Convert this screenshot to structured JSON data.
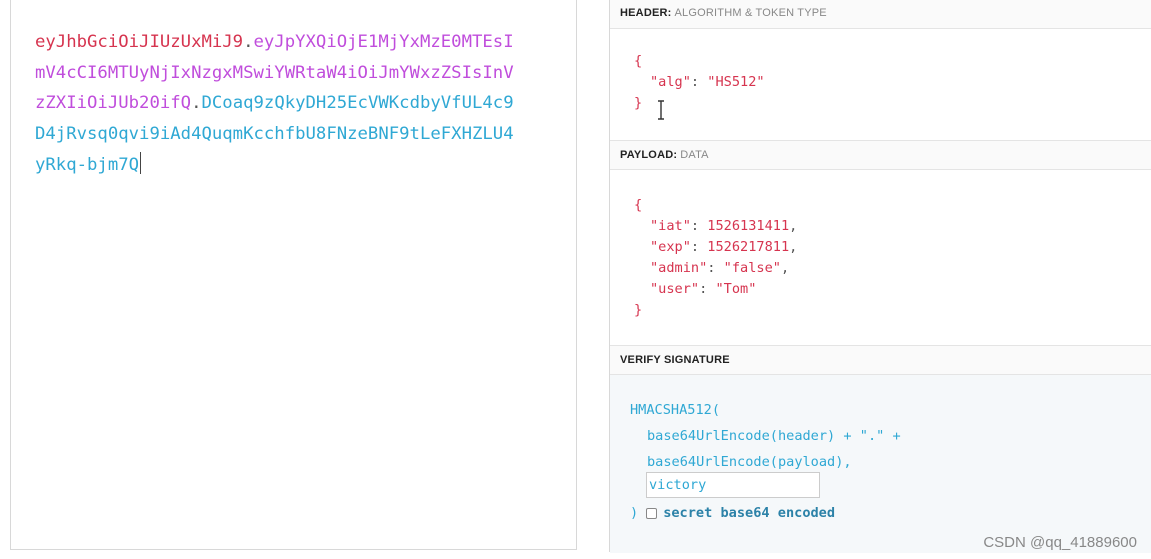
{
  "encoded": {
    "header_segment": "eyJhbGciOiJIUzUxMiJ9",
    "payload_segment": "eyJpYXQiOjE1MjYxMzE0MTEsImV4cCI6MTUyNjIxNzgxMSwiYWRtaW4iOiJmYWxzZSIsInVzZXIiOiJUb20ifQ",
    "signature_segment": "DCoaq9zQkyDH25EcVWKcdbyVfUL4c9D4jRvsq0qvi9iAd4QuqmKcchfbU8FNzeBNF9tLeFXHZLU4yRkq-bjm7Q",
    "separator": "."
  },
  "header_section": {
    "title": "HEADER:",
    "subtitle": "ALGORITHM & TOKEN TYPE",
    "open_brace": "{",
    "close_brace": "}",
    "fields": [
      {
        "key": "\"alg\"",
        "colon": ": ",
        "value": "\"HS512\"",
        "comma": ""
      }
    ]
  },
  "payload_section": {
    "title": "PAYLOAD:",
    "subtitle": "DATA",
    "open_brace": "{",
    "close_brace": "}",
    "fields": [
      {
        "key": "\"iat\"",
        "colon": ": ",
        "value": "1526131411",
        "comma": ","
      },
      {
        "key": "\"exp\"",
        "colon": ": ",
        "value": "1526217811",
        "comma": ","
      },
      {
        "key": "\"admin\"",
        "colon": ": ",
        "value": "\"false\"",
        "comma": ","
      },
      {
        "key": "\"user\"",
        "colon": ": ",
        "value": "\"Tom\"",
        "comma": ""
      }
    ]
  },
  "verify_section": {
    "title": "VERIFY SIGNATURE",
    "line1": "HMACSHA512(",
    "line2": "base64UrlEncode(header) + \".\" +",
    "line3": "base64UrlEncode(payload),",
    "secret_value": "victory",
    "closing": ")",
    "checkbox_label": "secret base64 encoded",
    "checkbox_checked": false
  },
  "watermark": "CSDN @qq_41889600",
  "colors": {
    "header": "#d6344f",
    "payload": "#c04ddc",
    "signature": "#2fa8d4"
  }
}
